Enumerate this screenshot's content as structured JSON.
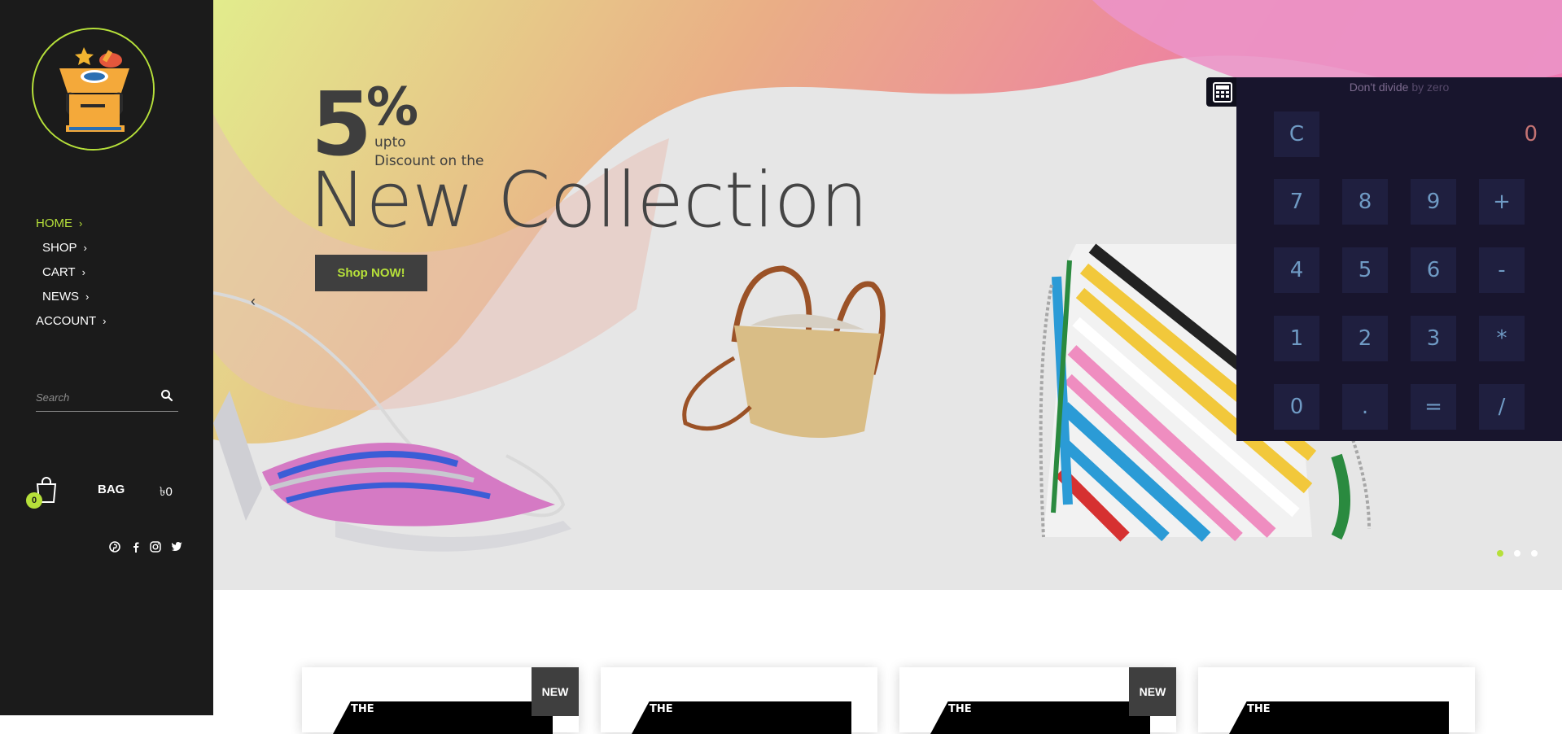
{
  "sidebar": {
    "nav": [
      {
        "label": "HOME",
        "active": true
      },
      {
        "label": "SHOP",
        "active": false
      },
      {
        "label": "CART",
        "active": false
      },
      {
        "label": "NEWS",
        "active": false
      },
      {
        "label": "ACCOUNT",
        "active": false
      }
    ],
    "search_placeholder": "Search",
    "bag": {
      "count": "0",
      "label": "BAG",
      "total": "৳0"
    },
    "social": [
      "pinterest-icon",
      "facebook-icon",
      "instagram-icon",
      "twitter-icon"
    ]
  },
  "hero": {
    "percent_number": "5",
    "percent_sign": "%",
    "upto": "upto",
    "discount_text": "Discount on the",
    "title": "New Collection",
    "cta": "Shop NOW!",
    "prev_arrow": "‹",
    "slides": 3,
    "active_slide": 0
  },
  "calculator": {
    "hint_main": "Don't divide",
    "hint_dim": " by zero",
    "display": "0",
    "clear": "C",
    "keys": [
      [
        "7",
        "8",
        "9",
        "+"
      ],
      [
        "4",
        "5",
        "6",
        "-"
      ],
      [
        "1",
        "2",
        "3",
        "*"
      ],
      [
        "0",
        ".",
        "=",
        "/"
      ]
    ]
  },
  "products": [
    {
      "badge": "NEW",
      "image_text": "THE"
    },
    {
      "badge": "",
      "image_text": "THE"
    },
    {
      "badge": "NEW",
      "image_text": "THE"
    },
    {
      "badge": "",
      "image_text": "THE"
    }
  ],
  "colors": {
    "accent": "#b6e03a",
    "sidebar": "#1b1b1b",
    "calc_bg": "#18152d",
    "calc_key": "#1f1f3f"
  }
}
